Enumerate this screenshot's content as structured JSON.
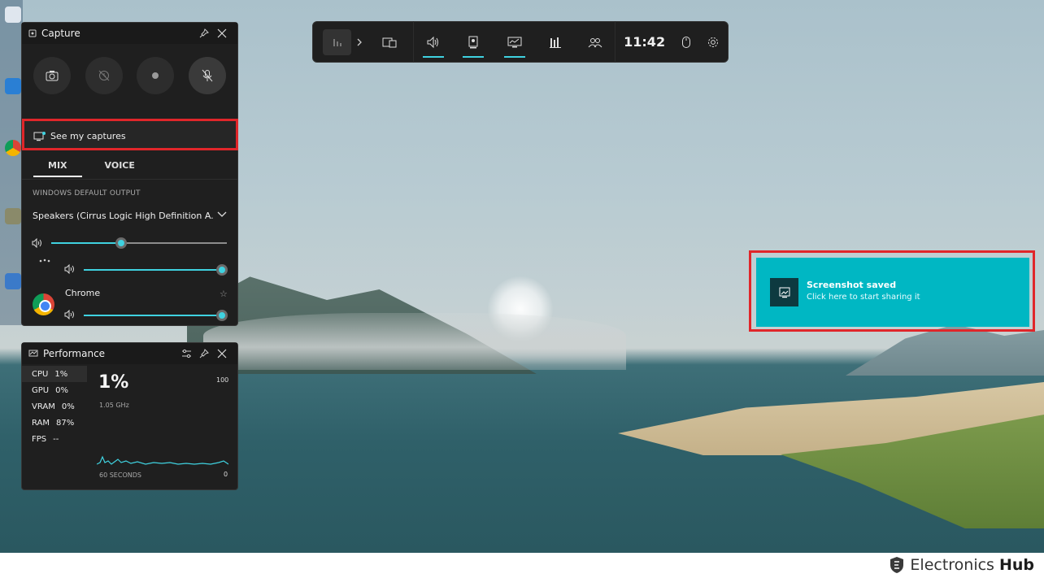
{
  "gamebar": {
    "clock": "11:42",
    "widgets": [
      "widget-menu-icon",
      "capture-icon",
      "audio-icon",
      "performance-icon",
      "resources-icon",
      "xbox-social-icon"
    ]
  },
  "capture": {
    "title": "Capture",
    "see_captures": "See my captures",
    "tabs": [
      "MIX",
      "VOICE"
    ],
    "output_label": "WINDOWS DEFAULT OUTPUT",
    "output_device": "Speakers (Cirrus Logic High Definition A...",
    "master_volume": 0.4,
    "system_volume": 1.0,
    "app_name": "Chrome",
    "app_volume": 1.0
  },
  "performance": {
    "title": "Performance",
    "stats": [
      {
        "name": "CPU",
        "value": "1%"
      },
      {
        "name": "GPU",
        "value": "0%"
      },
      {
        "name": "VRAM",
        "value": "0%"
      },
      {
        "name": "RAM",
        "value": "87%"
      },
      {
        "name": "FPS",
        "value": "--"
      }
    ],
    "big_value": "1%",
    "frequency": "1.05 GHz",
    "max": "100",
    "min": "0",
    "duration": "60 SECONDS"
  },
  "toast": {
    "title": "Screenshot saved",
    "subtitle": "Click here to start sharing it"
  },
  "footer": {
    "brand_name": "Electronics",
    "brand_hub": "Hub"
  },
  "colors": {
    "accent": "#3fd2e0",
    "toast": "#00b7c3",
    "highlight": "#e0262a",
    "panel": "#1f1f1f"
  }
}
